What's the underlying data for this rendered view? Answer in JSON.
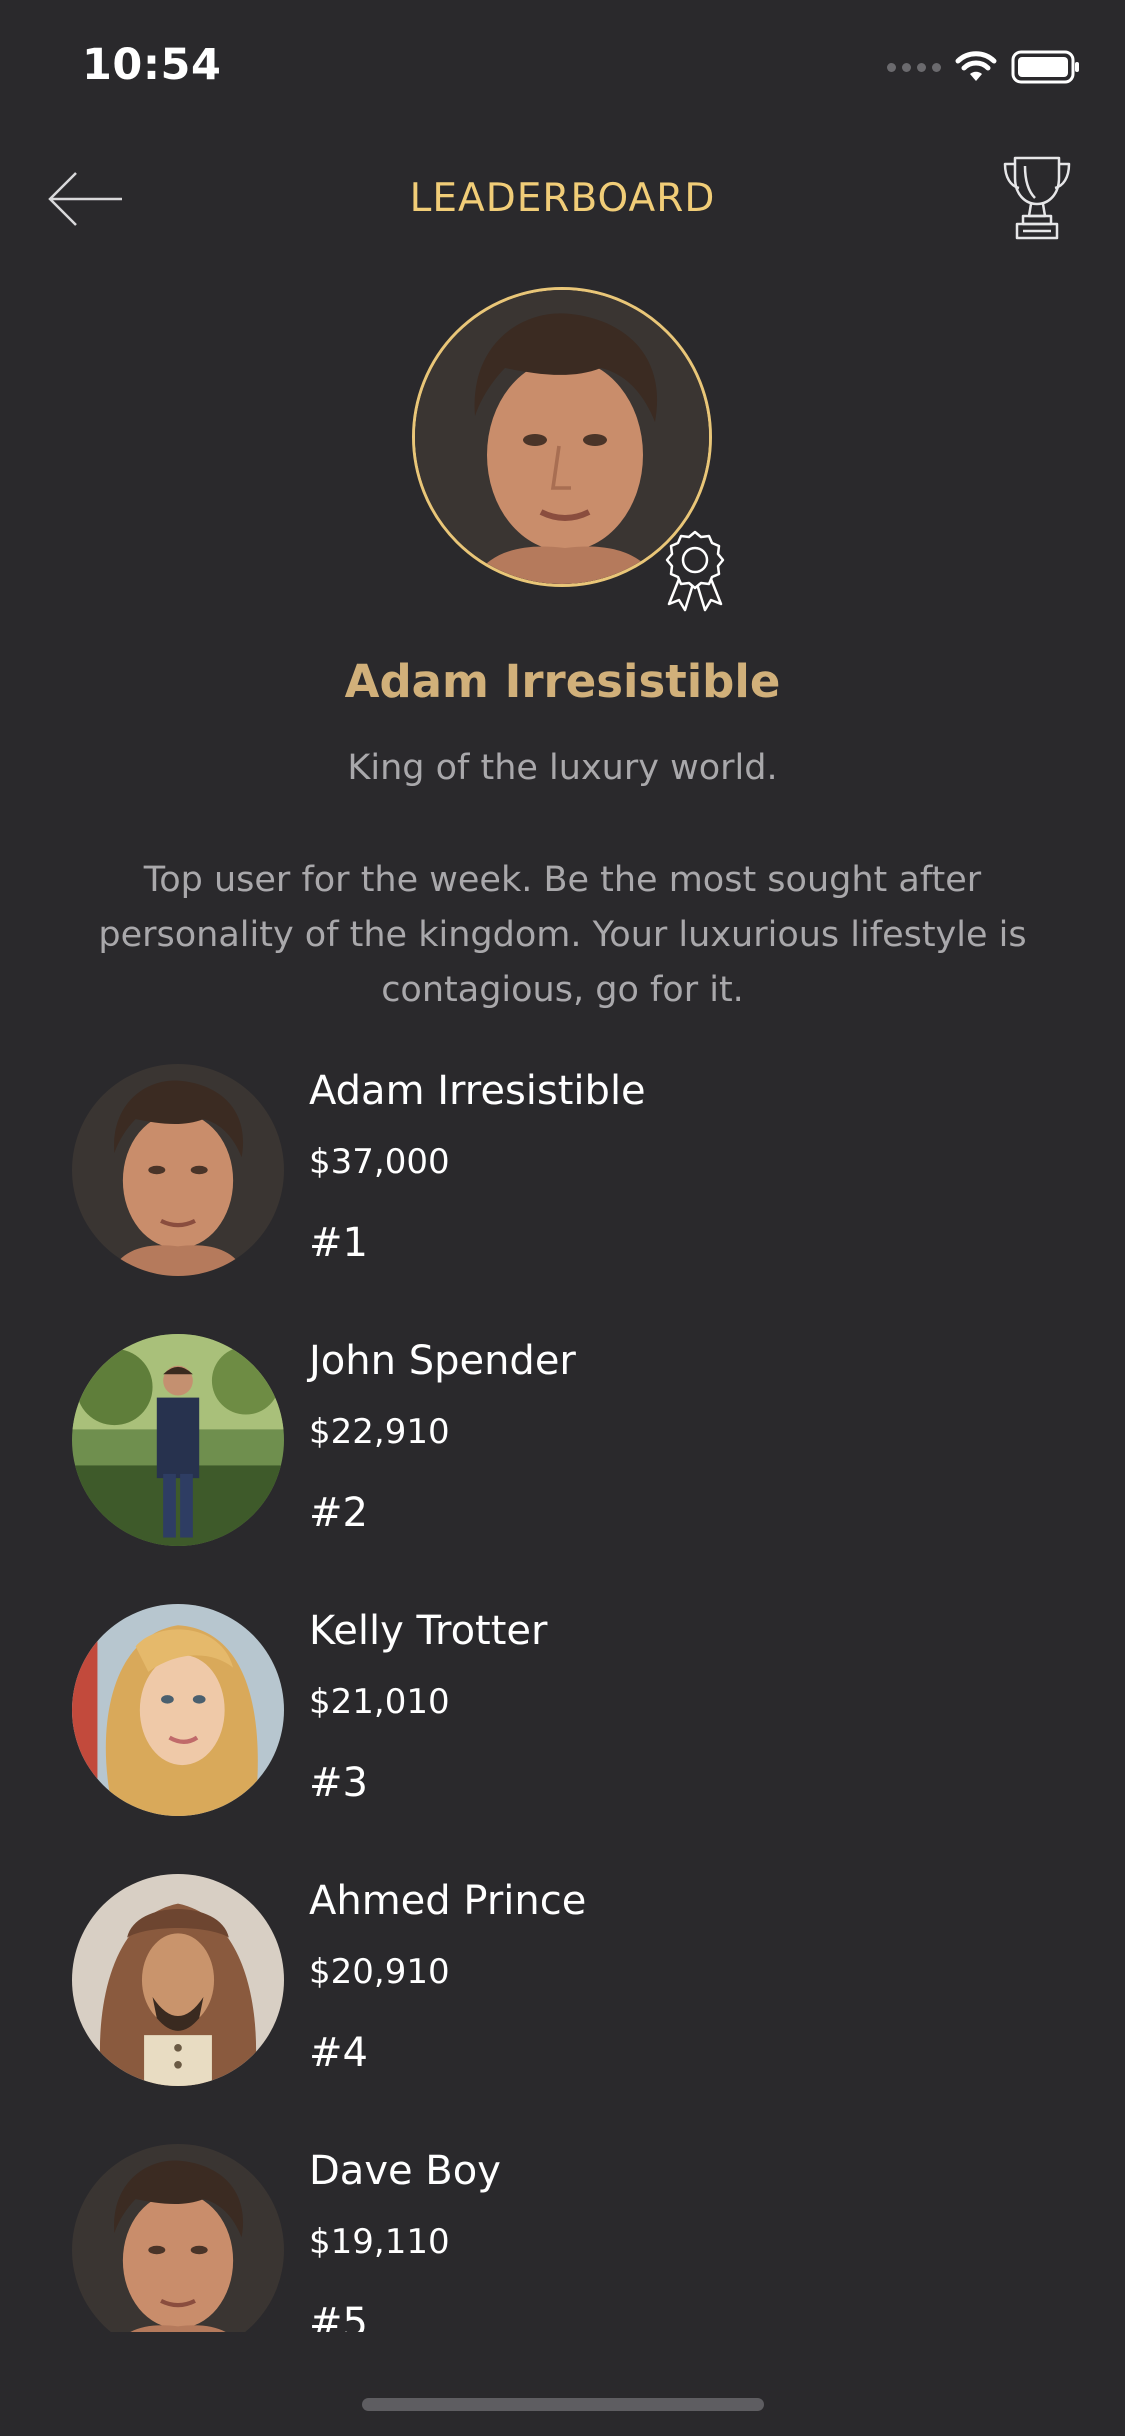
{
  "status_bar": {
    "time": "10:54",
    "icons": [
      "signal-icon",
      "wifi-icon",
      "battery-icon"
    ]
  },
  "nav": {
    "title": "LEADERBOARD",
    "back_icon": "arrow-left-icon",
    "action_icon": "trophy-icon"
  },
  "colors": {
    "background": "#2a292c",
    "accent_gold": "#f1cd78",
    "name_gold": "#d1b07a",
    "muted_text": "#a9a8ab"
  },
  "hero": {
    "name": "Adam Irresistible",
    "tagline": "King of the luxury world.",
    "description": "Top user for the week. Be the most sought after personality of the kingdom. Your luxurious lifestyle is contagious, go for it.",
    "badge_icon": "award-ribbon-icon"
  },
  "leaders": [
    {
      "name": "Adam Irresistible",
      "amount": "$37,000",
      "rank": "#1"
    },
    {
      "name": "John Spender",
      "amount": "$22,910",
      "rank": "#2"
    },
    {
      "name": "Kelly Trotter",
      "amount": "$21,010",
      "rank": "#3"
    },
    {
      "name": "Ahmed Prince",
      "amount": "$20,910",
      "rank": "#4"
    },
    {
      "name": "Dave Boy",
      "amount": "$19,110",
      "rank": "#5"
    }
  ]
}
